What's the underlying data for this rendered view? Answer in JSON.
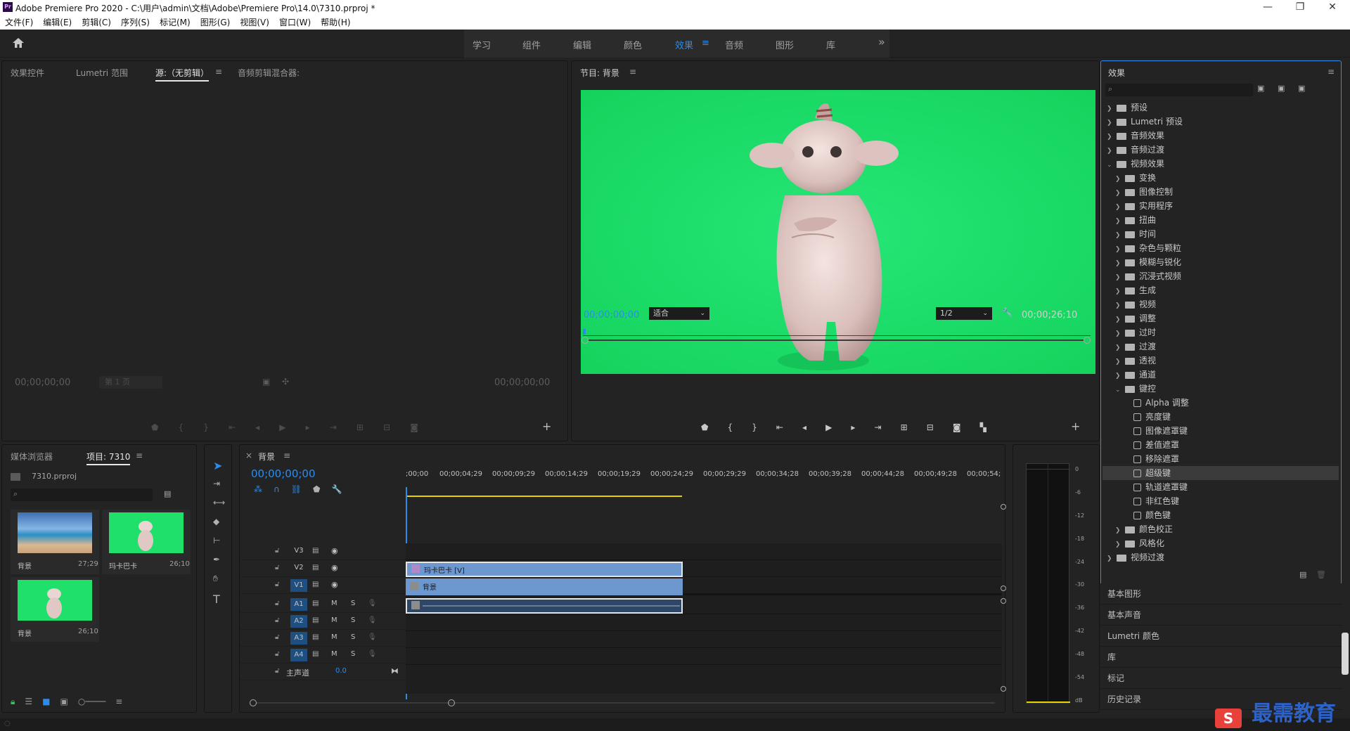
{
  "window": {
    "title": "Adobe Premiere Pro 2020 - C:\\用户\\admin\\文档\\Adobe\\Premiere Pro\\14.0\\7310.prproj *",
    "logo": "Pr",
    "minimize": "—",
    "maximize": "❐",
    "close": "✕"
  },
  "menu": [
    "文件(F)",
    "编辑(E)",
    "剪辑(C)",
    "序列(S)",
    "标记(M)",
    "图形(G)",
    "视图(V)",
    "窗口(W)",
    "帮助(H)"
  ],
  "workspaces": {
    "tabs": [
      "学习",
      "组件",
      "编辑",
      "颜色",
      "效果",
      "音频",
      "图形",
      "库"
    ],
    "active": "效果",
    "menu_glyph": "≡",
    "more": "»"
  },
  "source_panel": {
    "tabs": [
      "效果控件",
      "Lumetri 范围",
      "源:（无剪辑）",
      "音频剪辑混合器:"
    ],
    "menu_glyph": "≡",
    "timecode_left": "00;00;00;00",
    "page_select": "第 1 页",
    "timecode_right": "00;00;00;00"
  },
  "program_panel": {
    "title": "节目: 背景",
    "menu_glyph": "≡",
    "timecode": "00;00;00;00",
    "fit": "适合",
    "resolution": "1/2",
    "duration": "00;00;26;10"
  },
  "project_panel": {
    "tabs": [
      "媒体浏览器",
      "项目: 7310"
    ],
    "menu_glyph": "≡",
    "file": "7310.prproj",
    "items": [
      {
        "name": "背景",
        "duration": "27;29"
      },
      {
        "name": "玛卡巴卡",
        "duration": "26;10"
      },
      {
        "name": "背景",
        "duration": "26;10"
      }
    ]
  },
  "timeline": {
    "close": "×",
    "title": "背景",
    "menu_glyph": "≡",
    "timecode": "00;00;00;00",
    "ruler": [
      ";00;00",
      "00;00;04;29",
      "00;00;09;29",
      "00;00;14;29",
      "00;00;19;29",
      "00;00;24;29",
      "00;00;29;29",
      "00;00;34;28",
      "00;00;39;28",
      "00;00;44;28",
      "00;00;49;28",
      "00;00;54;"
    ],
    "video_tracks": [
      "V3",
      "V2",
      "V1"
    ],
    "audio_tracks": [
      "A1",
      "A2",
      "A3",
      "A4"
    ],
    "master": "主声道",
    "master_value": "0.0",
    "mute": "M",
    "solo": "S",
    "clips": [
      {
        "label": "玛卡巴卡 [V]",
        "track": "V2"
      },
      {
        "label": "背景",
        "track": "V1"
      }
    ]
  },
  "meter": {
    "scale": [
      "0",
      "-6",
      "-12",
      "-18",
      "-24",
      "-30",
      "-36",
      "-42",
      "-48",
      "-54",
      "dB"
    ]
  },
  "effects_panel": {
    "title": "效果",
    "menu_glyph": "≡",
    "tree": [
      {
        "label": "预设",
        "level": 0,
        "type": "folder",
        "open": false
      },
      {
        "label": "Lumetri 预设",
        "level": 0,
        "type": "folder",
        "open": false
      },
      {
        "label": "音频效果",
        "level": 0,
        "type": "folder",
        "open": false
      },
      {
        "label": "音频过渡",
        "level": 0,
        "type": "folder",
        "open": false
      },
      {
        "label": "视频效果",
        "level": 0,
        "type": "folder",
        "open": true
      },
      {
        "label": "变换",
        "level": 1,
        "type": "folder",
        "open": false
      },
      {
        "label": "图像控制",
        "level": 1,
        "type": "folder",
        "open": false
      },
      {
        "label": "实用程序",
        "level": 1,
        "type": "folder",
        "open": false
      },
      {
        "label": "扭曲",
        "level": 1,
        "type": "folder",
        "open": false
      },
      {
        "label": "时间",
        "level": 1,
        "type": "folder",
        "open": false
      },
      {
        "label": "杂色与颗粒",
        "level": 1,
        "type": "folder",
        "open": false
      },
      {
        "label": "模糊与锐化",
        "level": 1,
        "type": "folder",
        "open": false
      },
      {
        "label": "沉浸式视频",
        "level": 1,
        "type": "folder",
        "open": false
      },
      {
        "label": "生成",
        "level": 1,
        "type": "folder",
        "open": false
      },
      {
        "label": "视频",
        "level": 1,
        "type": "folder",
        "open": false
      },
      {
        "label": "调整",
        "level": 1,
        "type": "folder",
        "open": false
      },
      {
        "label": "过时",
        "level": 1,
        "type": "folder",
        "open": false
      },
      {
        "label": "过渡",
        "level": 1,
        "type": "folder",
        "open": false
      },
      {
        "label": "透视",
        "level": 1,
        "type": "folder",
        "open": false
      },
      {
        "label": "通道",
        "level": 1,
        "type": "folder",
        "open": false
      },
      {
        "label": "键控",
        "level": 1,
        "type": "folder",
        "open": true
      },
      {
        "label": "Alpha 调整",
        "level": 2,
        "type": "effect"
      },
      {
        "label": "亮度键",
        "level": 2,
        "type": "effect"
      },
      {
        "label": "图像遮罩键",
        "level": 2,
        "type": "effect"
      },
      {
        "label": "差值遮罩",
        "level": 2,
        "type": "effect"
      },
      {
        "label": "移除遮罩",
        "level": 2,
        "type": "effect"
      },
      {
        "label": "超级键",
        "level": 2,
        "type": "effect",
        "selected": true
      },
      {
        "label": "轨道遮罩键",
        "level": 2,
        "type": "effect"
      },
      {
        "label": "非红色键",
        "level": 2,
        "type": "effect"
      },
      {
        "label": "颜色键",
        "level": 2,
        "type": "effect"
      },
      {
        "label": "颜色校正",
        "level": 1,
        "type": "folder",
        "open": false
      },
      {
        "label": "风格化",
        "level": 1,
        "type": "folder",
        "open": false
      },
      {
        "label": "视频过渡",
        "level": 0,
        "type": "folder",
        "open": false
      }
    ]
  },
  "side_panels": [
    "基本图形",
    "基本声音",
    "Lumetri 颜色",
    "库",
    "标记",
    "历史记录"
  ],
  "watermark": "最需教育",
  "colors": {
    "accent": "#2d8ceb",
    "green_screen": "#1ee06a",
    "clip_blue": "#6c97cf",
    "audio_clip": "#2e4766"
  }
}
